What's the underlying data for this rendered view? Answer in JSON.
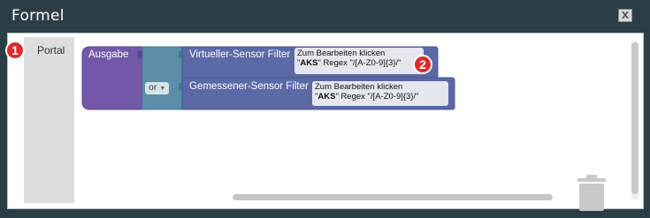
{
  "dialog": {
    "title": "Formel",
    "close_label": "X"
  },
  "toolbox": {
    "category_label": "Portal"
  },
  "badges": {
    "first": "1",
    "second": "2"
  },
  "blocks": {
    "output_label": "Ausgabe",
    "or_label": "or",
    "virtual_filter_label": "Virtueller-Sensor Filter",
    "virtual_field_line1": "Zum Bearbeiten klicken",
    "virtual_field_line2_prefix": "\"",
    "virtual_field_key": "AKS",
    "virtual_field_line2_rest": "\" Regex \"/[A-Z0-9]{3}/\"",
    "measured_filter_label": "Gemessener-Sensor Filter",
    "measured_field_line1": "Zum Bearbeiten klicken",
    "measured_field_line2_prefix": "\"",
    "measured_field_key": "AKS",
    "measured_field_line2_rest": "\" Regex \"/[A-Z0-9]{3}/\""
  },
  "colors": {
    "output_block": "#7357a8",
    "or_block": "#5b8fa8",
    "filter_block": "#5b69a6",
    "badge": "#dd2b2b",
    "dialog_bg": "#2c3e45"
  }
}
